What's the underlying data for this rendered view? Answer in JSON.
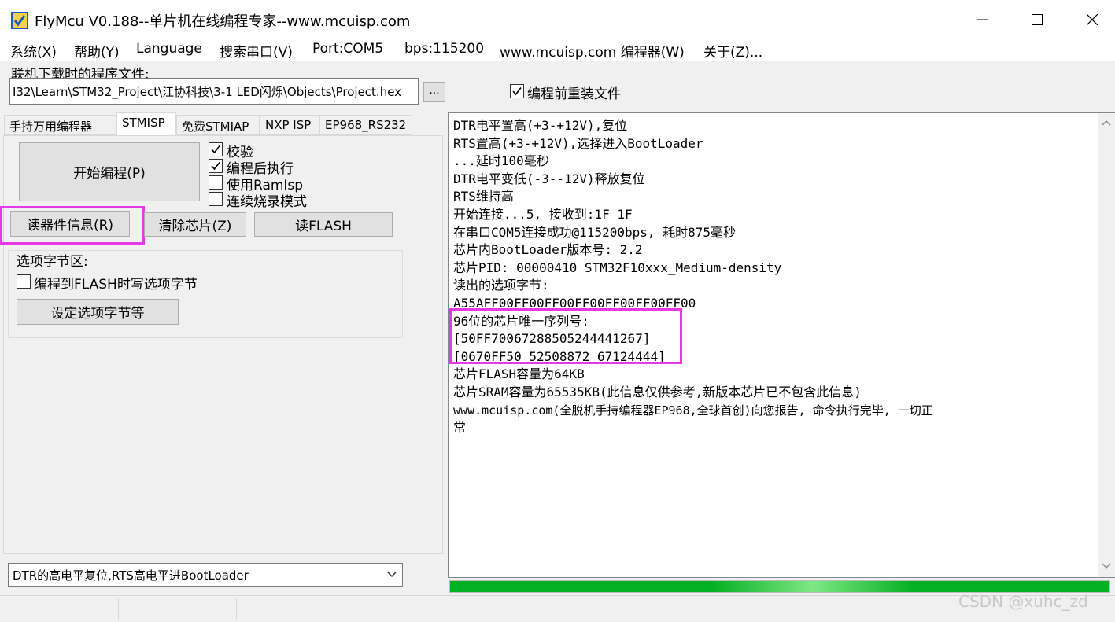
{
  "window": {
    "title": "FlyMcu V0.188--单片机在线编程专家--www.mcuisp.com",
    "minimize_glyph": "—",
    "maximize_glyph": "☐",
    "close_glyph": "✕"
  },
  "menu": [
    "系统(X)",
    "帮助(Y)",
    "Language",
    "搜索串口(V)",
    "Port:COM5",
    "bps:115200",
    "www.mcuisp.com 编程器(W)",
    "关于(Z)..."
  ],
  "file": {
    "label": "联机下载时的程序文件:",
    "path": "I32\\Learn\\STM32_Project\\江协科技\\3-1 LED闪烁\\Objects\\Project.hex",
    "browse_label": "...",
    "reload_label": "编程前重装文件",
    "reload_checked": true
  },
  "tabs": [
    "手持万用编程器",
    "STMISP",
    "免费STMIAP",
    "NXP ISP",
    "EP968_RS232"
  ],
  "active_tab": "STMISP",
  "stmisp": {
    "start_button": "开始编程(P)",
    "checkboxes": [
      {
        "label": "校验",
        "checked": true
      },
      {
        "label": "编程后执行",
        "checked": true
      },
      {
        "label": "使用RamIsp",
        "checked": false
      },
      {
        "label": "连续烧录模式",
        "checked": false
      }
    ],
    "read_info_button": "读器件信息(R)",
    "erase_button": "清除芯片(Z)",
    "read_flash_button": "读FLASH",
    "option_group_title": "选项字节区:",
    "write_option_label": "编程到FLASH时写选项字节",
    "write_option_checked": false,
    "set_option_button": "设定选项字节等"
  },
  "reset_mode": "DTR的高电平复位,RTS高电平进BootLoader",
  "log_lines": [
    "DTR电平置高(+3-+12V),复位",
    "RTS置高(+3-+12V),选择进入BootLoader",
    "...延时100毫秒",
    "DTR电平变低(-3--12V)释放复位",
    "RTS维持高",
    "开始连接...5, 接收到:1F 1F",
    "在串口COM5连接成功@115200bps, 耗时875毫秒",
    "芯片内BootLoader版本号: 2.2",
    "芯片PID: 00000410  STM32F10xxx_Medium-density",
    "读出的选项字节:",
    "A55AFF00FF00FF00FF00FF00FF00FF00",
    "96位的芯片唯一序列号:",
    "[50FF70067288505244441267]",
    "[0670FF50 52508872 67124444]",
    "芯片FLASH容量为64KB",
    "芯片SRAM容量为65535KB(此信息仅供参考,新版本芯片已不包含此信息)",
    "www.mcuisp.com(全脱机手持编程器EP968,全球首创)向您报告, 命令执行完毕, 一切正",
    "常"
  ],
  "progress": 1.0,
  "watermark": "CSDN @xuhc_zd",
  "colors": {
    "highlight": "#e639e6",
    "progress": "#06b025",
    "titlebar": "#ffffff",
    "panel": "#f0f0f0"
  }
}
